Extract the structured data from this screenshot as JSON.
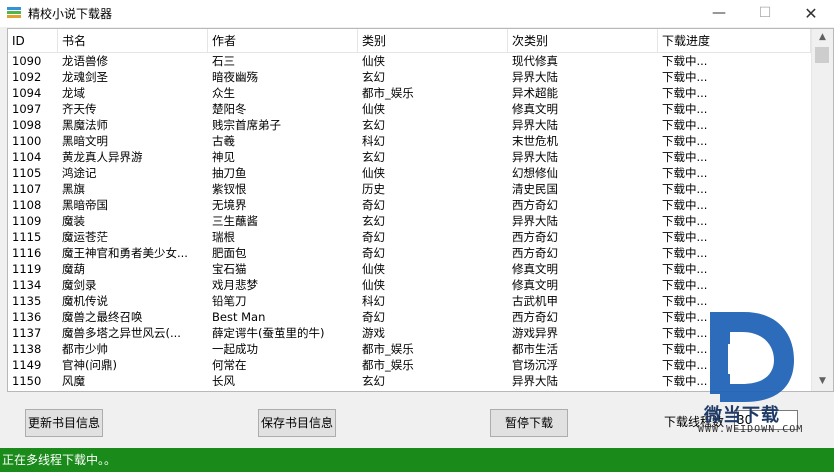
{
  "window": {
    "title": "精校小说下载器",
    "minimize_symbol": "—",
    "maximize_symbol": "☐",
    "close_symbol": "✕"
  },
  "table": {
    "columns": [
      "ID",
      "书名",
      "作者",
      "类别",
      "次类别",
      "下载进度"
    ],
    "rows": [
      [
        "1090",
        "龙语兽修",
        "石三",
        "仙侠",
        "现代修真",
        "下载中..."
      ],
      [
        "1092",
        "龙魂剑圣",
        "暗夜幽殇",
        "玄幻",
        "异界大陆",
        "下载中..."
      ],
      [
        "1094",
        "龙域",
        "众生",
        "都市_娱乐",
        "异术超能",
        "下载中..."
      ],
      [
        "1097",
        "齐天传",
        "楚阳冬",
        "仙侠",
        "修真文明",
        "下载中..."
      ],
      [
        "1098",
        "黑魔法师",
        "贱宗首席弟子",
        "玄幻",
        "异界大陆",
        "下载中..."
      ],
      [
        "1100",
        "黑暗文明",
        "古羲",
        "科幻",
        "末世危机",
        "下载中..."
      ],
      [
        "1104",
        "黄龙真人异界游",
        "神见",
        "玄幻",
        "异界大陆",
        "下载中..."
      ],
      [
        "1105",
        "鸿途记",
        "抽刀鱼",
        "仙侠",
        "幻想修仙",
        "下载中..."
      ],
      [
        "1107",
        "黑旗",
        "紫钗恨",
        "历史",
        "清史民国",
        "下载中..."
      ],
      [
        "1108",
        "黑暗帝国",
        "无境界",
        "奇幻",
        "西方奇幻",
        "下载中..."
      ],
      [
        "1109",
        "魔装",
        "三生蘸酱",
        "玄幻",
        "异界大陆",
        "下载中..."
      ],
      [
        "1115",
        "魔运苍茫",
        "瑞根",
        "奇幻",
        "西方奇幻",
        "下载中..."
      ],
      [
        "1116",
        "魔王神官和勇者美少女...",
        "肥面包",
        "奇幻",
        "西方奇幻",
        "下载中..."
      ],
      [
        "1119",
        "魔葫",
        "宝石猫",
        "仙侠",
        "修真文明",
        "下载中..."
      ],
      [
        "1134",
        "魔剑录",
        "戏月悲梦",
        "仙侠",
        "修真文明",
        "下载中..."
      ],
      [
        "1135",
        "魔机传说",
        "铅笔刀",
        "科幻",
        "古武机甲",
        "下载中..."
      ],
      [
        "1136",
        "魔兽之最终召唤",
        "Best Man",
        "奇幻",
        "西方奇幻",
        "下载中..."
      ],
      [
        "1137",
        "魔兽多塔之异世风云(...",
        "薛定谔牛(蚕茧里的牛)",
        "游戏",
        "游戏异界",
        "下载中..."
      ],
      [
        "1138",
        "都市少帅",
        "一起成功",
        "都市_娱乐",
        "都市生活",
        "下载中..."
      ],
      [
        "1149",
        "官神(问鼎)",
        "何常在",
        "都市_娱乐",
        "官场沉浮",
        "下载中..."
      ],
      [
        "1150",
        "风魔",
        "长风",
        "玄幻",
        "异界大陆",
        "下载中..."
      ]
    ]
  },
  "buttons": {
    "refresh": "更新书目信息",
    "save": "保存书目信息",
    "pause": "暂停下载"
  },
  "threads": {
    "label": "下载线程数",
    "value": "30"
  },
  "watermark": {
    "text": "微当下载",
    "url": "WWW.WEIDOWN.COM"
  },
  "status": {
    "text": "正在多线程下载中。。"
  },
  "colors": {
    "status_bg": "#1a8a1a",
    "watermark_blue": "#1a5fb4"
  },
  "icons": {
    "app": "books-icon",
    "scroll_up": "▲",
    "scroll_down": "▼"
  }
}
